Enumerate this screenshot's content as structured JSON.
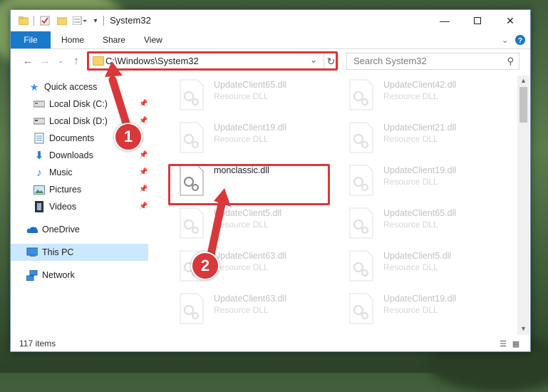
{
  "titlebar": {
    "title": "System32",
    "minimize_icon": "minimize-icon",
    "maximize_icon": "maximize-icon",
    "close_icon": "close-icon"
  },
  "ribbon": {
    "tabs": [
      "File",
      "Home",
      "Share",
      "View"
    ]
  },
  "address": {
    "path": "C:\\Windows\\System32",
    "search_placeholder": "Search System32"
  },
  "nav": {
    "quick_access": "Quick access",
    "items": [
      "Local Disk (C:)",
      "Local Disk (D:)",
      "Documents",
      "Downloads",
      "Music",
      "Pictures",
      "Videos"
    ],
    "onedrive": "OneDrive",
    "this_pc": "This PC",
    "network": "Network"
  },
  "files": {
    "left": [
      {
        "name": "UpdateClient65.dll",
        "type": "Resource DLL"
      },
      {
        "name": "UpdateClient19.dll",
        "type": "Resource DLL"
      },
      {
        "name": "monclassic.dll",
        "type": ""
      },
      {
        "name": "UpdateClient5.dll",
        "type": "Resource DLL"
      },
      {
        "name": "UpdateClient63.dll",
        "type": "Resource DLL"
      },
      {
        "name": "UpdateClient63.dll",
        "type": "Resource DLL"
      }
    ],
    "right": [
      {
        "name": "UpdateClient42.dll",
        "type": "Resource DLL"
      },
      {
        "name": "UpdateClient21.dll",
        "type": "Resource DLL"
      },
      {
        "name": "UpdateClient19.dll",
        "type": "Resource DLL"
      },
      {
        "name": "UpdateClient65.dll",
        "type": "Resource DLL"
      },
      {
        "name": "UpdateClient5.dll",
        "type": "Resource DLL"
      },
      {
        "name": "UpdateClient19.dll",
        "type": "Resource DLL"
      }
    ]
  },
  "status": {
    "item_count": "117 items"
  },
  "annotations": {
    "badge1": "1",
    "badge2": "2",
    "accent_color": "#d9383a"
  }
}
